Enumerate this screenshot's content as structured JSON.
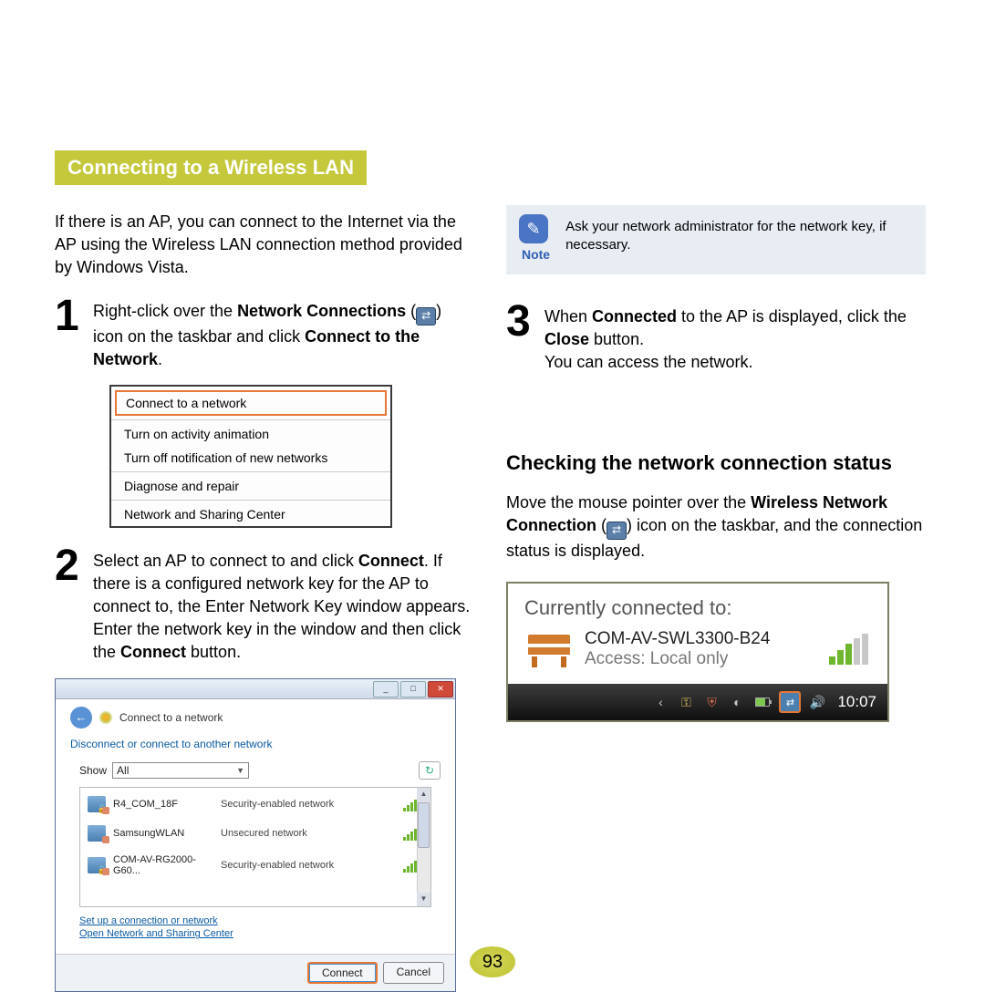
{
  "section_title": "Connecting to a Wireless LAN",
  "intro": "If there is an AP, you can connect to the Internet via the AP using the Wireless LAN connection method provided by Windows Vista.",
  "step1": {
    "pre": "Right-click over the ",
    "b1": "Network Connections",
    "mid": " (",
    "post1": ") icon on the taskbar and click ",
    "b2": "Connect to the Network",
    "post2": "."
  },
  "context_menu": {
    "items": [
      "Connect to a network",
      "Turn on activity animation",
      "Turn off notification of new networks",
      "Diagnose and repair",
      "Network and Sharing Center"
    ]
  },
  "step2": {
    "t1": "Select an AP to connect to and click ",
    "b1": "Connect",
    "t2": ". If there is a configured network key for the AP to connect to, the Enter Network Key window appears. Enter the network key in the window and then click the ",
    "b2": "Connect",
    "t3": " button."
  },
  "dialog": {
    "title": "Connect to a network",
    "subtitle": "Disconnect or connect to another network",
    "show_label": "Show",
    "show_value": "All",
    "networks": [
      {
        "name": "R4_COM_18F",
        "sec": "Security-enabled network"
      },
      {
        "name": "SamsungWLAN",
        "sec": "Unsecured network"
      },
      {
        "name": "COM-AV-RG2000-G60...",
        "sec": "Security-enabled network"
      }
    ],
    "link1": "Set up a connection or network",
    "link2": "Open Network and Sharing Center",
    "btn_connect": "Connect",
    "btn_cancel": "Cancel"
  },
  "note": {
    "label": "Note",
    "text": "Ask your network administrator for the network key, if necessary."
  },
  "step3": {
    "t1": "When ",
    "b1": "Connected",
    "t2": " to the AP is displayed, click the ",
    "b2": "Close",
    "t3": " button.",
    "t4": "You can access the network."
  },
  "subhead": "Checking the network connection status",
  "check_para": {
    "t1": "Move the mouse pointer over the ",
    "b1": "Wireless Network Connection",
    "t2": " (",
    "t3": ") icon on the taskbar, and the connection status is displayed."
  },
  "tooltip": {
    "title": "Currently connected to:",
    "net_name": "COM-AV-SWL3300-B24",
    "access": "Access:  Local only",
    "time": "10:07"
  },
  "page_number": "93"
}
